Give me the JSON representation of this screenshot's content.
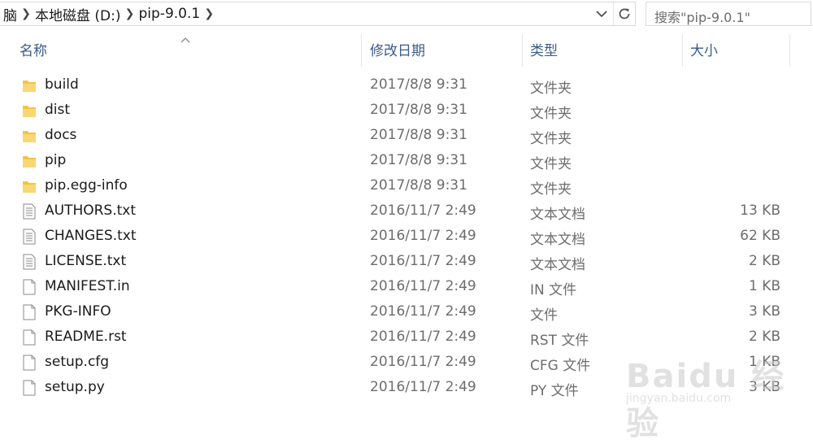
{
  "address": {
    "crumbs": [
      "脑",
      "本地磁盘 (D:)",
      "pip-9.0.1"
    ],
    "search_placeholder": "搜索\"pip-9.0.1\""
  },
  "columns": {
    "name": "名称",
    "date": "修改日期",
    "type": "类型",
    "size": "大小"
  },
  "files": [
    {
      "name": "build",
      "date": "2017/8/8 9:31",
      "type": "文件夹",
      "size": "",
      "icon": "folder-icon"
    },
    {
      "name": "dist",
      "date": "2017/8/8 9:31",
      "type": "文件夹",
      "size": "",
      "icon": "folder-icon"
    },
    {
      "name": "docs",
      "date": "2017/8/8 9:31",
      "type": "文件夹",
      "size": "",
      "icon": "folder-icon"
    },
    {
      "name": "pip",
      "date": "2017/8/8 9:31",
      "type": "文件夹",
      "size": "",
      "icon": "folder-icon"
    },
    {
      "name": "pip.egg-info",
      "date": "2017/8/8 9:31",
      "type": "文件夹",
      "size": "",
      "icon": "folder-icon"
    },
    {
      "name": "AUTHORS.txt",
      "date": "2016/11/7 2:49",
      "type": "文本文档",
      "size": "13 KB",
      "icon": "text-file-icon"
    },
    {
      "name": "CHANGES.txt",
      "date": "2016/11/7 2:49",
      "type": "文本文档",
      "size": "62 KB",
      "icon": "text-file-icon"
    },
    {
      "name": "LICENSE.txt",
      "date": "2016/11/7 2:49",
      "type": "文本文档",
      "size": "2 KB",
      "icon": "text-file-icon"
    },
    {
      "name": "MANIFEST.in",
      "date": "2016/11/7 2:49",
      "type": "IN 文件",
      "size": "1 KB",
      "icon": "blank-file-icon"
    },
    {
      "name": "PKG-INFO",
      "date": "2016/11/7 2:49",
      "type": "文件",
      "size": "3 KB",
      "icon": "blank-file-icon"
    },
    {
      "name": "README.rst",
      "date": "2016/11/7 2:49",
      "type": "RST 文件",
      "size": "2 KB",
      "icon": "blank-file-icon"
    },
    {
      "name": "setup.cfg",
      "date": "2016/11/7 2:49",
      "type": "CFG 文件",
      "size": "1 KB",
      "icon": "blank-file-icon"
    },
    {
      "name": "setup.py",
      "date": "2016/11/7 2:49",
      "type": "PY 文件",
      "size": "3 KB",
      "icon": "blank-file-icon"
    }
  ],
  "watermark": {
    "brand": "Baidu 经验",
    "url": "jingyan.baidu.com"
  },
  "colors": {
    "header_text": "#3b5a8a",
    "folder": "#f5c343",
    "secondary_text": "#6d6d6d"
  }
}
